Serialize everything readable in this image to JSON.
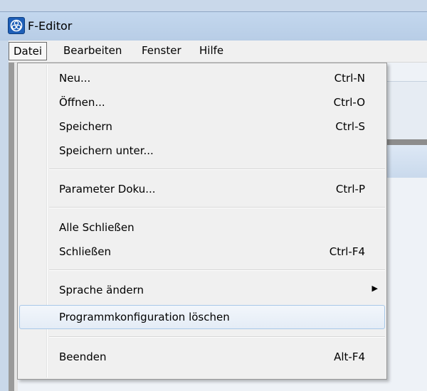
{
  "window": {
    "title": "F-Editor",
    "icon": "app-logo-icon",
    "colors": {
      "titlebar": "#c3d7ee",
      "menu_bg": "#f0f0f0",
      "highlight_border": "#a8c8e8"
    }
  },
  "menubar": {
    "items": [
      {
        "label": "Datei",
        "active": true
      },
      {
        "label": "Bearbeiten",
        "active": false
      },
      {
        "label": "Fenster",
        "active": false
      },
      {
        "label": "Hilfe",
        "active": false
      }
    ]
  },
  "dropdown": {
    "items": [
      {
        "label": "Neu...",
        "shortcut": "Ctrl-N"
      },
      {
        "label": "Öffnen...",
        "shortcut": "Ctrl-O"
      },
      {
        "label": "Speichern",
        "shortcut": "Ctrl-S"
      },
      {
        "label": "Speichern unter...",
        "shortcut": ""
      },
      {
        "label": "Parameter Doku...",
        "shortcut": "Ctrl-P"
      },
      {
        "label": "Alle Schließen",
        "shortcut": ""
      },
      {
        "label": "Schließen",
        "shortcut": "Ctrl-F4"
      },
      {
        "label": "Sprache ändern",
        "shortcut": "",
        "submenu": true,
        "arrow_icon": "submenu-arrow-icon"
      },
      {
        "label": "Programmkonfiguration löschen",
        "shortcut": "",
        "highlighted": true
      },
      {
        "label": "Beenden",
        "shortcut": "Alt-F4"
      }
    ]
  }
}
